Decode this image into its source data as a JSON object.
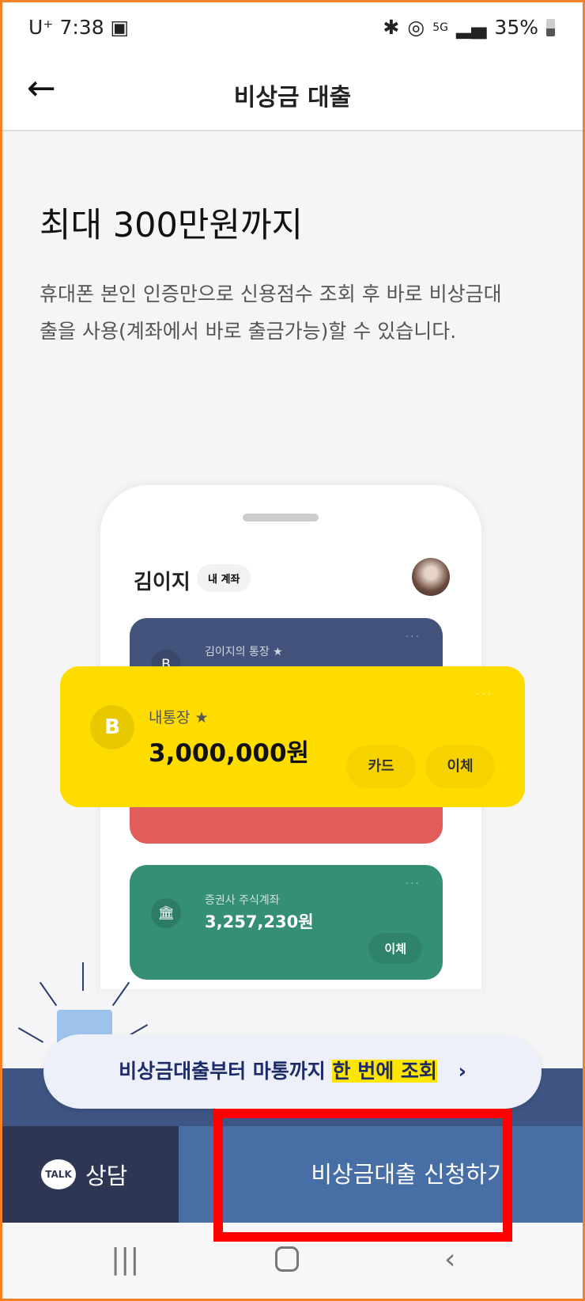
{
  "status_bar": {
    "carrier": "U⁺",
    "time": "7:38",
    "battery": "35%"
  },
  "header": {
    "title": "비상금 대출",
    "back_icon": "arrow-left-icon"
  },
  "hero": {
    "heading": "최대 300만원까지",
    "description": "휴대폰 본인 인증만으로 신용점수 조회 후 바로 비상금대출을 사용(계좌에서 바로 출금가능)할 수 있습니다."
  },
  "mock_phone": {
    "user_name": "김이지",
    "chip": "내 계좌",
    "accounts": [
      {
        "title": "김이지의 통장 ★",
        "color": "#43537b"
      },
      {
        "title": "내통장 ★",
        "amount": "3,000,000원",
        "buttons": [
          "카드",
          "이체"
        ],
        "color": "#ffdc00"
      },
      {
        "title": "증권사 주식계좌",
        "amount": "3,257,230원",
        "buttons": [
          "이체"
        ],
        "color": "#348f75"
      }
    ]
  },
  "banner": {
    "text": "비상금대출부터 마통까지 ",
    "highlight": "한 번에 조회",
    "chevron": "›"
  },
  "bottom": {
    "talk_icon": "TALK",
    "talk_label": "상담",
    "apply_label": "비상금대출 신청하기"
  },
  "colors": {
    "apply": "#476ea5",
    "talk": "#2f3654",
    "highlight_box": "#ff0000"
  }
}
